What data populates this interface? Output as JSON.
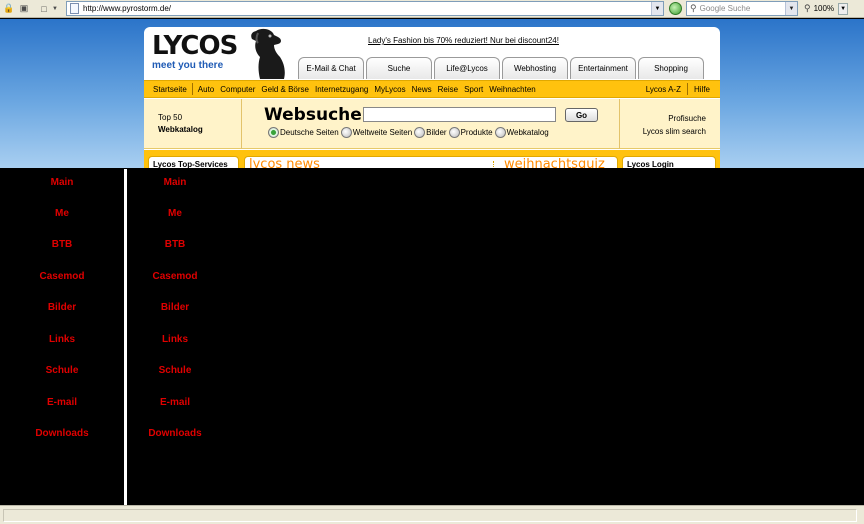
{
  "browser": {
    "url": "http://www.pyrostorm.de/",
    "search_placeholder": "Google Suche",
    "zoom": "100%"
  },
  "lycos": {
    "logo": "LYCOS",
    "slogan": "meet you there",
    "promo": "Lady's Fashion bis 70% reduziert! Nur bei discount24!",
    "tabs": [
      "E-Mail & Chat",
      "Suche",
      "Life@Lycos",
      "Webhosting",
      "Entertainment",
      "Shopping"
    ],
    "nav": [
      "Startseite",
      "Auto",
      "Computer",
      "Geld & Börse",
      "Internetzugang",
      "MyLycos",
      "News",
      "Reise",
      "Sport",
      "Weihnachten"
    ],
    "nav_right": [
      "Lycos A-Z",
      "Hilfe"
    ],
    "top50": {
      "line1": "Top 50",
      "line2": "Webkatalog"
    },
    "websuche": "Websuche:",
    "go": "Go",
    "radios": [
      "Deutsche Seiten",
      "Weltweite Seiten",
      "Bilder",
      "Produkte",
      "Webkatalog"
    ],
    "right_links": [
      "Profisuche",
      "Lycos slim search"
    ],
    "boxes": {
      "services": "Lycos Top-Services",
      "news": "lycos news",
      "quiz": "weihnachtsquiz",
      "login": "Lycos Login"
    }
  },
  "menu_left": [
    "Main",
    "Me",
    "BTB",
    "Casemod",
    "Bilder",
    "Links",
    "Schule",
    "E-mail",
    "Downloads"
  ],
  "menu_right": [
    "Main",
    "Me",
    "BTB",
    "Casemod",
    "Bilder",
    "Links",
    "Schule",
    "E-mail",
    "Downloads"
  ],
  "colors": {
    "menu_text": "#e00000",
    "lycos_yellow": "#ffc20e",
    "background": "#000000"
  }
}
